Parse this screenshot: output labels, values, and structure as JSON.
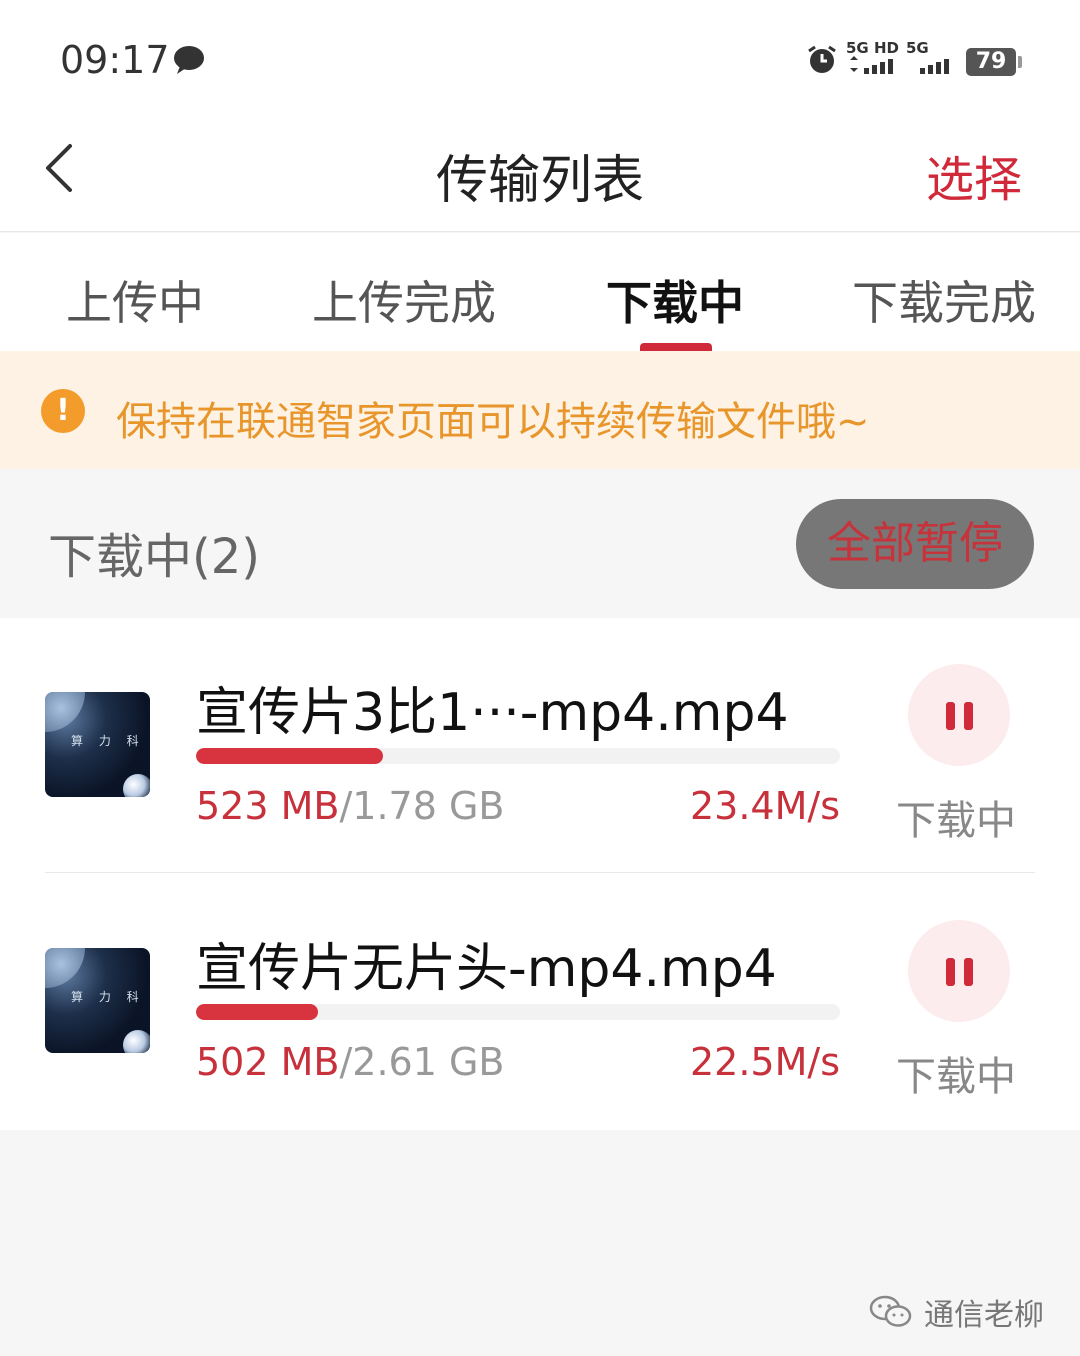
{
  "status_bar": {
    "time": "09:17",
    "net1_label": "5G HD",
    "net2_label": "5G",
    "battery": "79",
    "icons": [
      "message-bubble-icon",
      "alarm-icon",
      "signal-icon",
      "signal-icon"
    ]
  },
  "header": {
    "title": "传输列表",
    "select_label": "选择",
    "back_icon": "chevron-left-icon"
  },
  "tabs": [
    {
      "label": "上传中",
      "active": false
    },
    {
      "label": "上传完成",
      "active": false
    },
    {
      "label": "下载中",
      "active": true
    },
    {
      "label": "下载完成",
      "active": false
    }
  ],
  "notice": {
    "icon": "exclamation-icon",
    "text": "保持在联通智家页面可以持续传输文件哦~"
  },
  "section": {
    "title": "下载中(2)",
    "pause_all_label": "全部暂停"
  },
  "downloads": [
    {
      "name": "宣传片3比1···-mp4.mp4",
      "downloaded": "523  MB",
      "total": "/1.78  GB",
      "speed": "23.4M/s",
      "progress": 0.29,
      "status": "下载中",
      "thumb_text": "算 力 科"
    },
    {
      "name": "宣传片无片头-mp4.mp4",
      "downloaded": "502  MB",
      "total": "/2.61  GB",
      "speed": "22.5M/s",
      "progress": 0.19,
      "status": "下载中",
      "thumb_text": "算 力 科"
    }
  ],
  "watermark": {
    "text": "通信老柳"
  },
  "colors": {
    "accent": "#d0293a",
    "notice_bg": "#fdf2e3",
    "notice_text": "#e8962b"
  }
}
